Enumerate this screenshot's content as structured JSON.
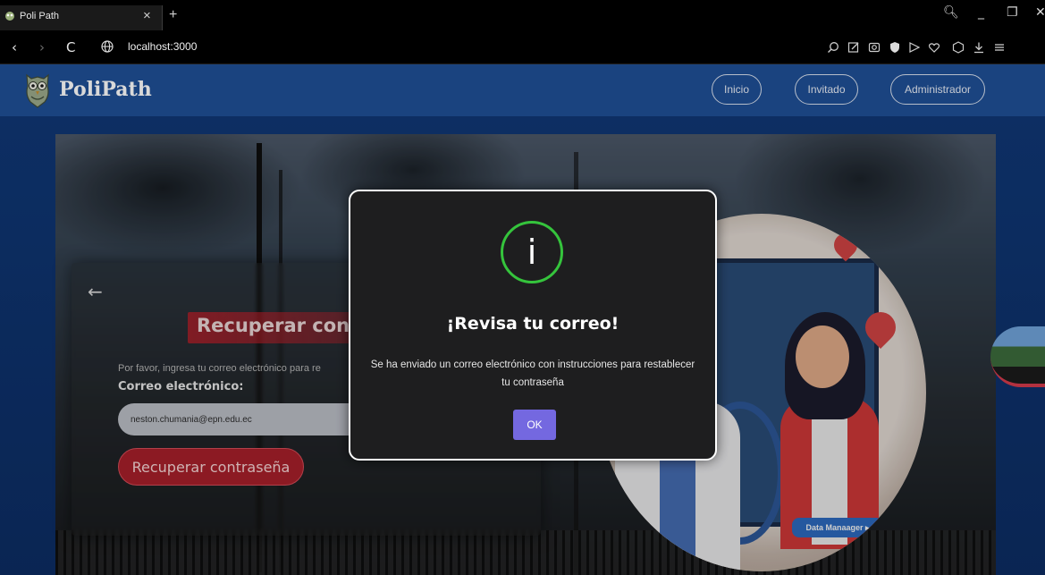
{
  "browser": {
    "tab_title": "Poli Path",
    "tab_close": "×",
    "new_tab": "+",
    "url": "localhost:3000",
    "window_controls": [
      "🔍",
      "_",
      "❐",
      "✕"
    ]
  },
  "header": {
    "logo_text": "PoliPath",
    "nav": [
      "Inicio",
      "Invitado",
      "Administrador"
    ]
  },
  "card": {
    "back": "←",
    "title": "Recuperar cont",
    "description": "Por favor, ingresa tu correo electrónico para re",
    "email_label": "Correo electrónico:",
    "email_value": "neston.chumania@epn.edu.ec",
    "submit": "Recuperar contraseña"
  },
  "illustration": {
    "badge": "Data Manaager ▸"
  },
  "modal": {
    "icon": "i",
    "title": "¡Revisa tu correo!",
    "message": "Se ha enviado un correo electrónico con instrucciones para restablecer tu contraseña",
    "ok": "OK"
  },
  "colors": {
    "header_bg": "#1f4f96",
    "modal_ok": "#7468e0",
    "success_ring": "#35c43c",
    "danger": "#a51f2a"
  }
}
